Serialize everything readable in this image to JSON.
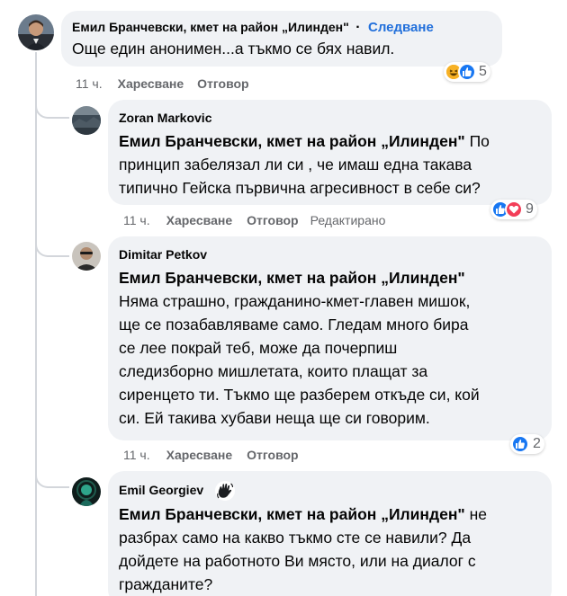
{
  "comments": [
    {
      "author": "Емил Бранчевски, кмет на район „Илинден\"",
      "follow_label": "Следване",
      "dot": "·",
      "text": "Още един анонимен...а тъкмо се бях навил.",
      "time": "11 ч.",
      "like_label": "Харесване",
      "reply_label": "Отговор",
      "reactions": {
        "count": "5",
        "types": [
          "haha",
          "like"
        ]
      }
    },
    {
      "author": "Zoran Markovic",
      "mention": "Емил Бранчевски, кмет на район „Илинден\"",
      "text_line1_rest": " По",
      "text_line2": "принцип забелязал ли си , че имаш една такава",
      "text_line3": "типично Гейска първична агресивност в себе си?",
      "time": "11 ч.",
      "like_label": "Харесване",
      "reply_label": "Отговор",
      "edited_label": "Редактирано",
      "reactions": {
        "count": "9",
        "types": [
          "like",
          "love"
        ]
      }
    },
    {
      "author": "Dimitar Petkov",
      "mention": "Емил Бранчевски, кмет на район „Илинден\"",
      "lines": [
        "Няма страшно, гражданино-кмет-главен мишок,",
        "ще се позабавляваме само. Гледам много бира",
        "се лее покрай теб, може да почерпиш",
        "следизборно мишлетата, които плащат за",
        "сиренцето ти. Тъкмо ще разберем откъде си, кой",
        "си. Ей такива хубави неща ще си говорим."
      ],
      "time": "11 ч.",
      "like_label": "Харесване",
      "reply_label": "Отговор",
      "reactions": {
        "count": "2",
        "types": [
          "like"
        ]
      }
    },
    {
      "author": "Emil Georgiev",
      "badge_icon": "waving-hand-icon",
      "mention": "Емил Бранчевски, кмет на район „Илинден\"",
      "text_line1_rest": " не",
      "text_line2": "разбрах само на какво тъкмо сте се навили? Да",
      "text_line3": "дойдете на работното Ви място, или на диалог с",
      "text_line4": "гражданите?"
    }
  ],
  "colors": {
    "bubble": "#f0f2f5",
    "follow": "#216fdb",
    "meta": "#65676b",
    "like": "#1877f2",
    "love": "#f33e58",
    "haha": "#f7b125"
  }
}
